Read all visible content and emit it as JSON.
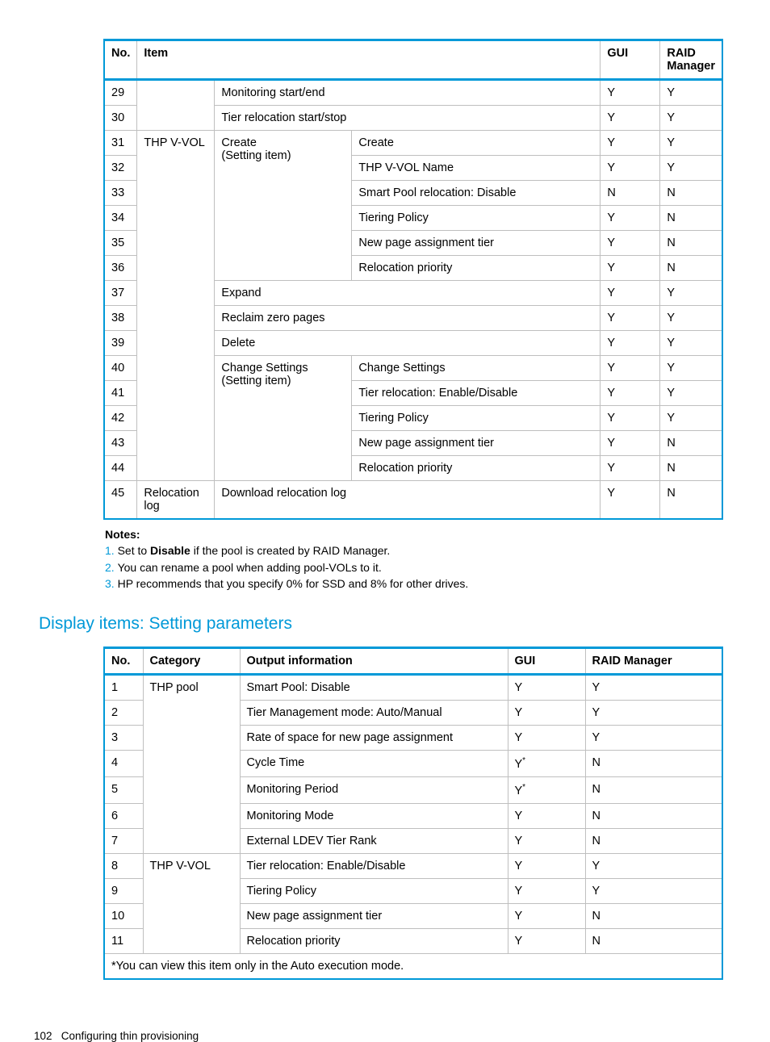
{
  "table1": {
    "headers": {
      "no": "No.",
      "item": "Item",
      "gui": "GUI",
      "raid": "RAID Manager"
    },
    "rows": [
      {
        "no": "29",
        "item_l2": "",
        "action": "Monitoring start/end",
        "detail": "",
        "gui": "Y",
        "raid": "Y"
      },
      {
        "no": "30",
        "item_l2": "",
        "action": "Tier relocation start/stop",
        "detail": "",
        "gui": "Y",
        "raid": "Y"
      },
      {
        "no": "31",
        "item_l2": "THP V-VOL",
        "action": "Create",
        "action_sub": "(Setting item)",
        "detail": "Create",
        "gui": "Y",
        "raid": "Y"
      },
      {
        "no": "32",
        "detail": "THP V-VOL Name",
        "gui": "Y",
        "raid": "Y"
      },
      {
        "no": "33",
        "detail": "Smart Pool relocation: Disable",
        "gui": "N",
        "raid": "N"
      },
      {
        "no": "34",
        "detail": "Tiering Policy",
        "gui": "Y",
        "raid": "N"
      },
      {
        "no": "35",
        "detail": "New page assignment tier",
        "gui": "Y",
        "raid": "N"
      },
      {
        "no": "36",
        "detail": "Relocation priority",
        "gui": "Y",
        "raid": "N"
      },
      {
        "no": "37",
        "action": "Expand",
        "gui": "Y",
        "raid": "Y"
      },
      {
        "no": "38",
        "action": "Reclaim zero pages",
        "gui": "Y",
        "raid": "Y"
      },
      {
        "no": "39",
        "action": "Delete",
        "gui": "Y",
        "raid": "Y"
      },
      {
        "no": "40",
        "action": "Change Settings",
        "action_sub": "(Setting item)",
        "detail": "Change Settings",
        "gui": "Y",
        "raid": "Y"
      },
      {
        "no": "41",
        "detail": "Tier relocation: Enable/Disable",
        "gui": "Y",
        "raid": "Y"
      },
      {
        "no": "42",
        "detail": "Tiering Policy",
        "gui": "Y",
        "raid": "Y"
      },
      {
        "no": "43",
        "detail": "New page assignment tier",
        "gui": "Y",
        "raid": "N"
      },
      {
        "no": "44",
        "detail": "Relocation priority",
        "gui": "Y",
        "raid": "N"
      },
      {
        "no": "45",
        "item_l2": "Relocation log",
        "action": "Download relocation log",
        "gui": "Y",
        "raid": "N"
      }
    ]
  },
  "notes": {
    "title": "Notes:",
    "n1": {
      "num": "1.",
      "text_pre": "Set to ",
      "bold": "Disable",
      "text_post": " if the pool is created by RAID Manager."
    },
    "n2": {
      "num": "2.",
      "text": "You can rename a pool when adding pool-VOLs to it."
    },
    "n3": {
      "num": "3.",
      "text": "HP recommends that you specify 0% for SSD and 8% for other drives."
    }
  },
  "section_heading": "Display items: Setting parameters",
  "table2": {
    "headers": {
      "no": "No.",
      "category": "Category",
      "output": "Output information",
      "gui": "GUI",
      "raid": "RAID Manager"
    },
    "rows": [
      {
        "no": "1",
        "category": "THP pool",
        "output": "Smart Pool: Disable",
        "gui": "Y",
        "raid": "Y"
      },
      {
        "no": "2",
        "output": "Tier Management mode: Auto/Manual",
        "gui": "Y",
        "raid": "Y"
      },
      {
        "no": "3",
        "output": "Rate of space for new page assignment",
        "gui": "Y",
        "raid": "Y"
      },
      {
        "no": "4",
        "output": "Cycle Time",
        "gui": "Y*",
        "raid": "N",
        "gui_has_star": true
      },
      {
        "no": "5",
        "output": "Monitoring Period",
        "gui": "Y*",
        "raid": "N",
        "gui_has_star": true
      },
      {
        "no": "6",
        "output": "Monitoring Mode",
        "gui": "Y",
        "raid": "N"
      },
      {
        "no": "7",
        "output": "External LDEV Tier Rank",
        "gui": "Y",
        "raid": "N"
      },
      {
        "no": "8",
        "category": "THP V-VOL",
        "output": "Tier relocation: Enable/Disable",
        "gui": "Y",
        "raid": "Y"
      },
      {
        "no": "9",
        "output": "Tiering Policy",
        "gui": "Y",
        "raid": "Y"
      },
      {
        "no": "10",
        "output": "New page assignment tier",
        "gui": "Y",
        "raid": "N"
      },
      {
        "no": "11",
        "output": "Relocation priority",
        "gui": "Y",
        "raid": "N"
      }
    ],
    "footnote": "*You can view this item only in the Auto execution mode."
  },
  "footer": {
    "page": "102",
    "title": "Configuring thin provisioning"
  }
}
